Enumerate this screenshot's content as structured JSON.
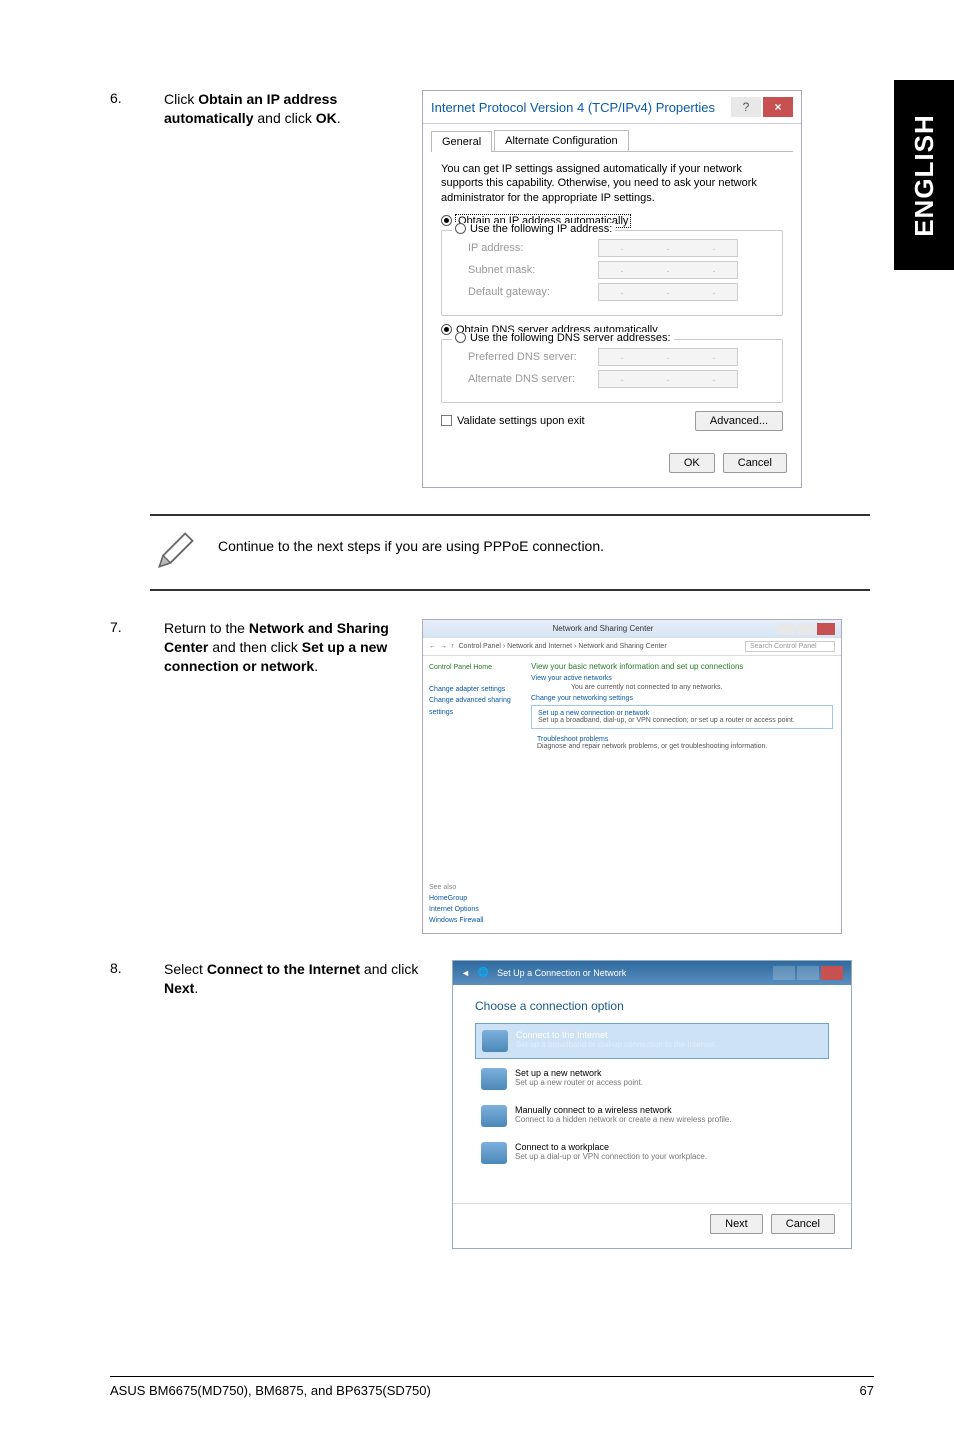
{
  "side_label": "ENGLISH",
  "steps": {
    "s6": {
      "num": "6.",
      "text_before": "Click ",
      "b1": "Obtain an IP address automatically",
      "mid": " and click ",
      "b2": "OK",
      "after": "."
    },
    "s7": {
      "num": "7.",
      "text_before": "Return to the ",
      "b1": "Network and Sharing Center",
      "mid": " and then click ",
      "b2": "Set up a new connection or network",
      "after": "."
    },
    "s8": {
      "num": "8.",
      "text_before": "Select ",
      "b1": "Connect to the Internet",
      "mid": " and click ",
      "b2": "Next",
      "after": "."
    }
  },
  "note": "Continue to the next steps if you are using PPPoE connection.",
  "dlg1": {
    "title": "Internet Protocol Version 4 (TCP/IPv4) Properties",
    "help": "?",
    "close": "×",
    "tab_general": "General",
    "tab_alt": "Alternate Configuration",
    "desc": "You can get IP settings assigned automatically if your network supports this capability. Otherwise, you need to ask your network administrator for the appropriate IP settings.",
    "r_obtain_ip": "Obtain an IP address automatically",
    "r_use_ip": "Use the following IP address:",
    "lbl_ip": "IP address:",
    "lbl_subnet": "Subnet mask:",
    "lbl_gateway": "Default gateway:",
    "r_obtain_dns": "Obtain DNS server address automatically",
    "r_use_dns": "Use the following DNS server addresses:",
    "lbl_pref_dns": "Preferred DNS server:",
    "lbl_alt_dns": "Alternate DNS server:",
    "chk_validate": "Validate settings upon exit",
    "btn_adv": "Advanced...",
    "btn_ok": "OK",
    "btn_cancel": "Cancel"
  },
  "dlg2": {
    "title": "Network and Sharing Center",
    "path": "Control Panel  ›  Network and Internet  ›  Network and Sharing Center",
    "search_ph": "Search Control Panel",
    "side_home": "Control Panel Home",
    "side_adapter": "Change adapter settings",
    "side_adv": "Change advanced sharing settings",
    "h1": "View your basic network information and set up connections",
    "sub_active": "View your active networks",
    "no_conn": "You are currently not connected to any networks.",
    "sub_change": "Change your networking settings",
    "opt1_t": "Set up a new connection or network",
    "opt1_d": "Set up a broadband, dial-up, or VPN connection; or set up a router or access point.",
    "opt2_t": "Troubleshoot problems",
    "opt2_d": "Diagnose and repair network problems, or get troubleshooting information.",
    "seealso_lbl": "See also",
    "seealso_1": "HomeGroup",
    "seealso_2": "Internet Options",
    "seealso_3": "Windows Firewall"
  },
  "dlg3": {
    "title": "Set Up a Connection or Network",
    "hd": "Choose a connection option",
    "opt1_t": "Connect to the Internet",
    "opt1_d": "Set up a broadband or dial-up connection to the Internet.",
    "opt2_t": "Set up a new network",
    "opt2_d": "Set up a new router or access point.",
    "opt3_t": "Manually connect to a wireless network",
    "opt3_d": "Connect to a hidden network or create a new wireless profile.",
    "opt4_t": "Connect to a workplace",
    "opt4_d": "Set up a dial-up or VPN connection to your workplace.",
    "btn_next": "Next",
    "btn_cancel": "Cancel"
  },
  "footer": {
    "left": "ASUS BM6675(MD750), BM6875, and BP6375(SD750)",
    "right": "67"
  }
}
